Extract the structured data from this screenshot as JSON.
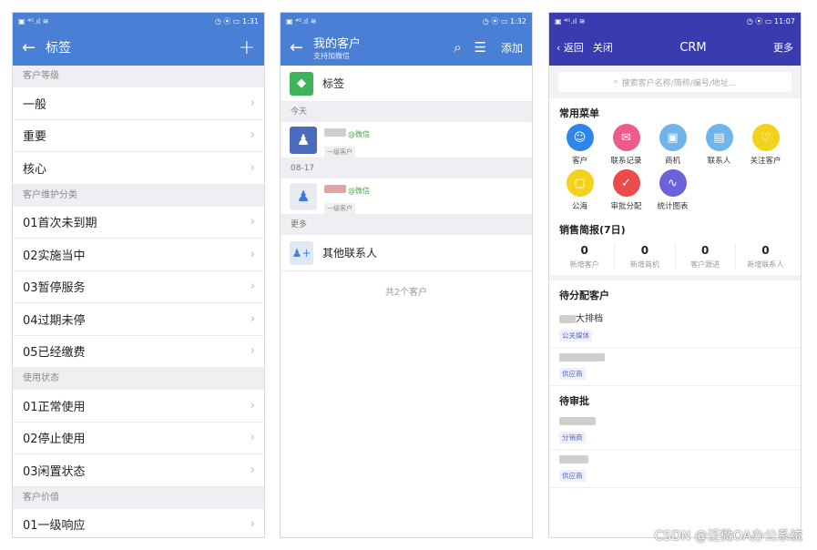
{
  "phone1": {
    "status": {
      "left": "▣ ⁴ᴳ.ıl ≋",
      "right": "◷ ⦿ ▭ 1:31"
    },
    "nav": {
      "back": "←",
      "title": "标签",
      "add": "+"
    },
    "sections": [
      {
        "header": "客户等级",
        "items": [
          "一般",
          "重要",
          "核心"
        ]
      },
      {
        "header": "客户维护分类",
        "items": [
          "01首次未到期",
          "02实施当中",
          "03暂停服务",
          "04过期未停",
          "05已经缴费"
        ]
      },
      {
        "header": "使用状态",
        "items": [
          "01正常使用",
          "02停止使用",
          "03闲置状态"
        ]
      },
      {
        "header": "客户价值",
        "items": [
          "01一级响应"
        ]
      }
    ]
  },
  "phone2": {
    "status": {
      "left": "▣ ⁴ᴳ.ıl ≋",
      "right": "◷ ⦿ ▭ 1:32"
    },
    "nav": {
      "back": "←",
      "title": "我的客户",
      "subtitle": "支持加微信",
      "add": "添加"
    },
    "tag_label": "标签",
    "sec_today": "今天",
    "sec_date": "08-17",
    "sec_more": "更多",
    "wx": "@微信",
    "level": "一级客户",
    "other": "其他联系人",
    "total": "共2个客户"
  },
  "phone3": {
    "status": {
      "left": "▣ ⁴ᴳ.ıl ≋",
      "right": "◷ ⦿ ▭ 11:07"
    },
    "nav": {
      "back": "返回",
      "close": "关闭",
      "title": "CRM",
      "more": "更多"
    },
    "search_placeholder": "搜索客户名称/简称/编号/地址...",
    "menu_title": "常用菜单",
    "menu": [
      {
        "label": "客户",
        "color": "#2f86e8",
        "icon": "☺"
      },
      {
        "label": "联系记录",
        "color": "#ef5a8c",
        "icon": "✉"
      },
      {
        "label": "商机",
        "color": "#6fb4ea",
        "icon": "▣"
      },
      {
        "label": "联系人",
        "color": "#6fb4ea",
        "icon": "▤"
      },
      {
        "label": "关注客户",
        "color": "#f4d21b",
        "icon": "♡"
      },
      {
        "label": "公海",
        "color": "#f4d21b",
        "icon": "▢"
      },
      {
        "label": "审批分配",
        "color": "#ec4b4b",
        "icon": "✓"
      },
      {
        "label": "统计图表",
        "color": "#6a62d8",
        "icon": "∿"
      }
    ],
    "report_title": "销售简报(7日)",
    "stats": [
      {
        "n": "0",
        "l": "新增客户"
      },
      {
        "n": "0",
        "l": "新增商机"
      },
      {
        "n": "0",
        "l": "客户跟进"
      },
      {
        "n": "0",
        "l": "新增联系人"
      }
    ],
    "assign_title": "待分配客户",
    "assign": [
      {
        "name": "大排档",
        "tag": "公关媒体"
      },
      {
        "name": "",
        "tag": "供应商"
      }
    ],
    "approve_title": "待审批",
    "approve": [
      {
        "tag": "分销商"
      },
      {
        "tag": "供应商"
      }
    ],
    "watermark": "CSDN @泛微OA办公系统"
  }
}
